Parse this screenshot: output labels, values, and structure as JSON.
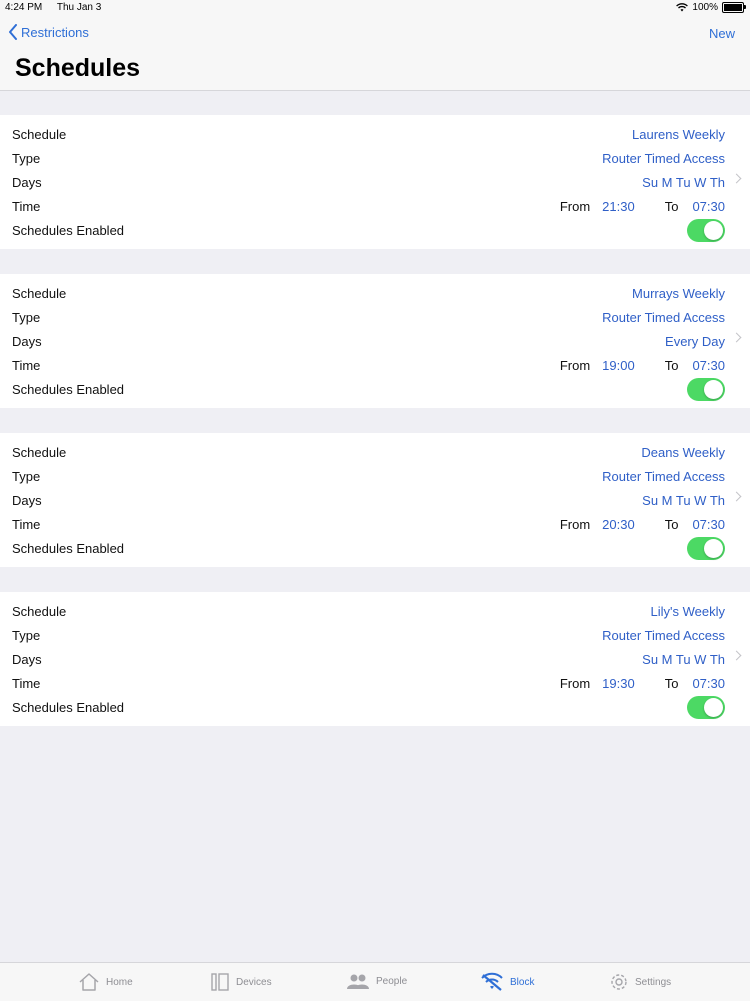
{
  "status_bar": {
    "time": "4:24 PM",
    "date": "Thu Jan 3",
    "battery": "100%"
  },
  "nav": {
    "back_label": "Restrictions",
    "new_label": "New",
    "title": "Schedules"
  },
  "labels": {
    "schedule": "Schedule",
    "type": "Type",
    "days": "Days",
    "time": "Time",
    "enabled": "Schedules Enabled",
    "from": "From",
    "to": "To"
  },
  "schedules": [
    {
      "name": "Laurens Weekly",
      "type": "Router Timed Access",
      "days": "Su M Tu W Th",
      "from": "21:30",
      "to": "07:30",
      "enabled": true
    },
    {
      "name": "Murrays Weekly",
      "type": "Router Timed Access",
      "days": "Every Day",
      "from": "19:00",
      "to": "07:30",
      "enabled": true
    },
    {
      "name": "Deans Weekly",
      "type": "Router Timed Access",
      "days": "Su M Tu W Th",
      "from": "20:30",
      "to": "07:30",
      "enabled": true
    },
    {
      "name": "Lily's Weekly",
      "type": "Router Timed Access",
      "days": "Su M Tu W Th",
      "from": "19:30",
      "to": "07:30",
      "enabled": true
    }
  ],
  "tabs": [
    {
      "label": "Home",
      "icon": "home-icon",
      "active": false
    },
    {
      "label": "Devices",
      "icon": "devices-icon",
      "active": false
    },
    {
      "label": "People",
      "icon": "people-icon",
      "active": false
    },
    {
      "label": "Block",
      "icon": "block-wifi-icon",
      "active": true
    },
    {
      "label": "Settings",
      "icon": "gear-icon",
      "active": false
    }
  ],
  "colors": {
    "accent": "#2f6fd6",
    "value": "#2f5fc7",
    "toggle_on": "#4cd964",
    "background": "#efeff4"
  }
}
